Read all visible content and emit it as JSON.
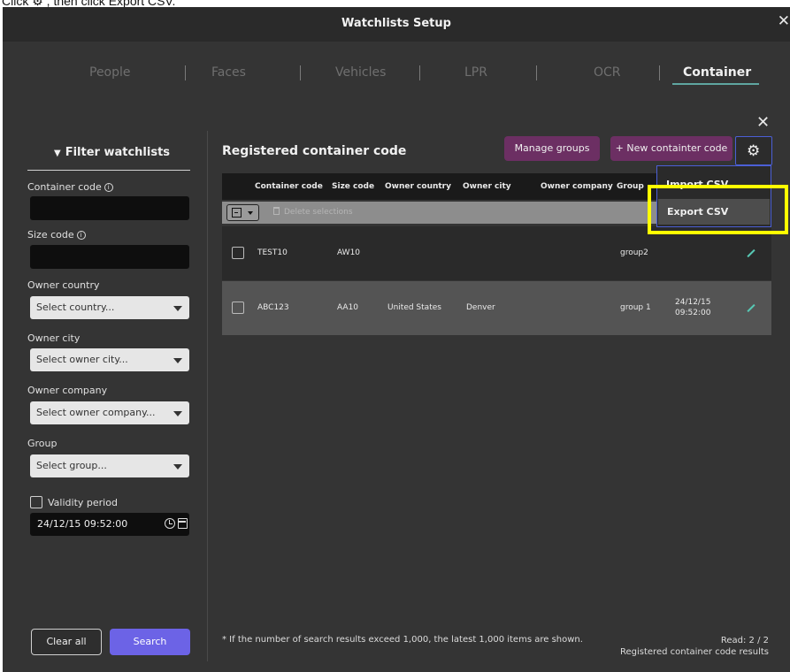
{
  "instruction": "Click ⚙ , then click Export CSV.",
  "window": {
    "title": "Watchlists Setup",
    "close_glyph": "✕"
  },
  "tabs": [
    {
      "label": "People",
      "active": false
    },
    {
      "label": "Faces",
      "active": false
    },
    {
      "label": "Vehicles",
      "active": false
    },
    {
      "label": "LPR",
      "active": false
    },
    {
      "label": "OCR",
      "active": false
    },
    {
      "label": "Container",
      "active": true
    }
  ],
  "panel_close_glyph": "✕",
  "filter": {
    "title": "Filter watchlists",
    "funnel_glyph": "▼",
    "container_code_label": "Container code",
    "size_code_label": "Size code",
    "info_glyph": "i",
    "owner_country_label": "Owner country",
    "owner_country_placeholder": "Select country...",
    "owner_city_label": "Owner city",
    "owner_city_placeholder": "Select owner city...",
    "owner_company_label": "Owner company",
    "owner_company_placeholder": "Select owner company...",
    "group_label": "Group",
    "group_placeholder": "Select group...",
    "validity_label": "Validity period",
    "validity_value": "24/12/15 09:52:00",
    "clear_label": "Clear all",
    "search_label": "Search"
  },
  "main": {
    "title": "Registered container code",
    "manage_groups_label": "Manage groups",
    "new_code_label": "+ New containter code",
    "gear_glyph": "⚙",
    "columns": [
      "Container code",
      "Size code",
      "Owner country",
      "Owner city",
      "Owner company",
      "Group"
    ],
    "delete_selections_label": "Delete selections",
    "rows": [
      {
        "container_code": "TEST10",
        "size_code": "AW10",
        "owner_country": "",
        "owner_city": "",
        "owner_company": "",
        "group": "group2",
        "date": "",
        "time": ""
      },
      {
        "container_code": "ABC123",
        "size_code": "AA10",
        "owner_country": "United States",
        "owner_city": "Denver",
        "owner_company": "",
        "group": "group 1",
        "date": "24/12/15",
        "time": "09:52:00"
      }
    ],
    "settings_menu": {
      "import_label": "Import CSV",
      "export_label": "Export CSV"
    },
    "footnote": "* If the number of search results exceed 1,000, the latest 1,000 items are shown.",
    "read_count": "Read: 2 / 2",
    "read_sub": "Registered container code results"
  },
  "colors": {
    "accent_purple": "#6c63e6",
    "button_plum": "#6c2f63",
    "tab_underline": "#5fa6a0",
    "highlight": "#ffff00",
    "edit_icon": "#57c8b4"
  }
}
